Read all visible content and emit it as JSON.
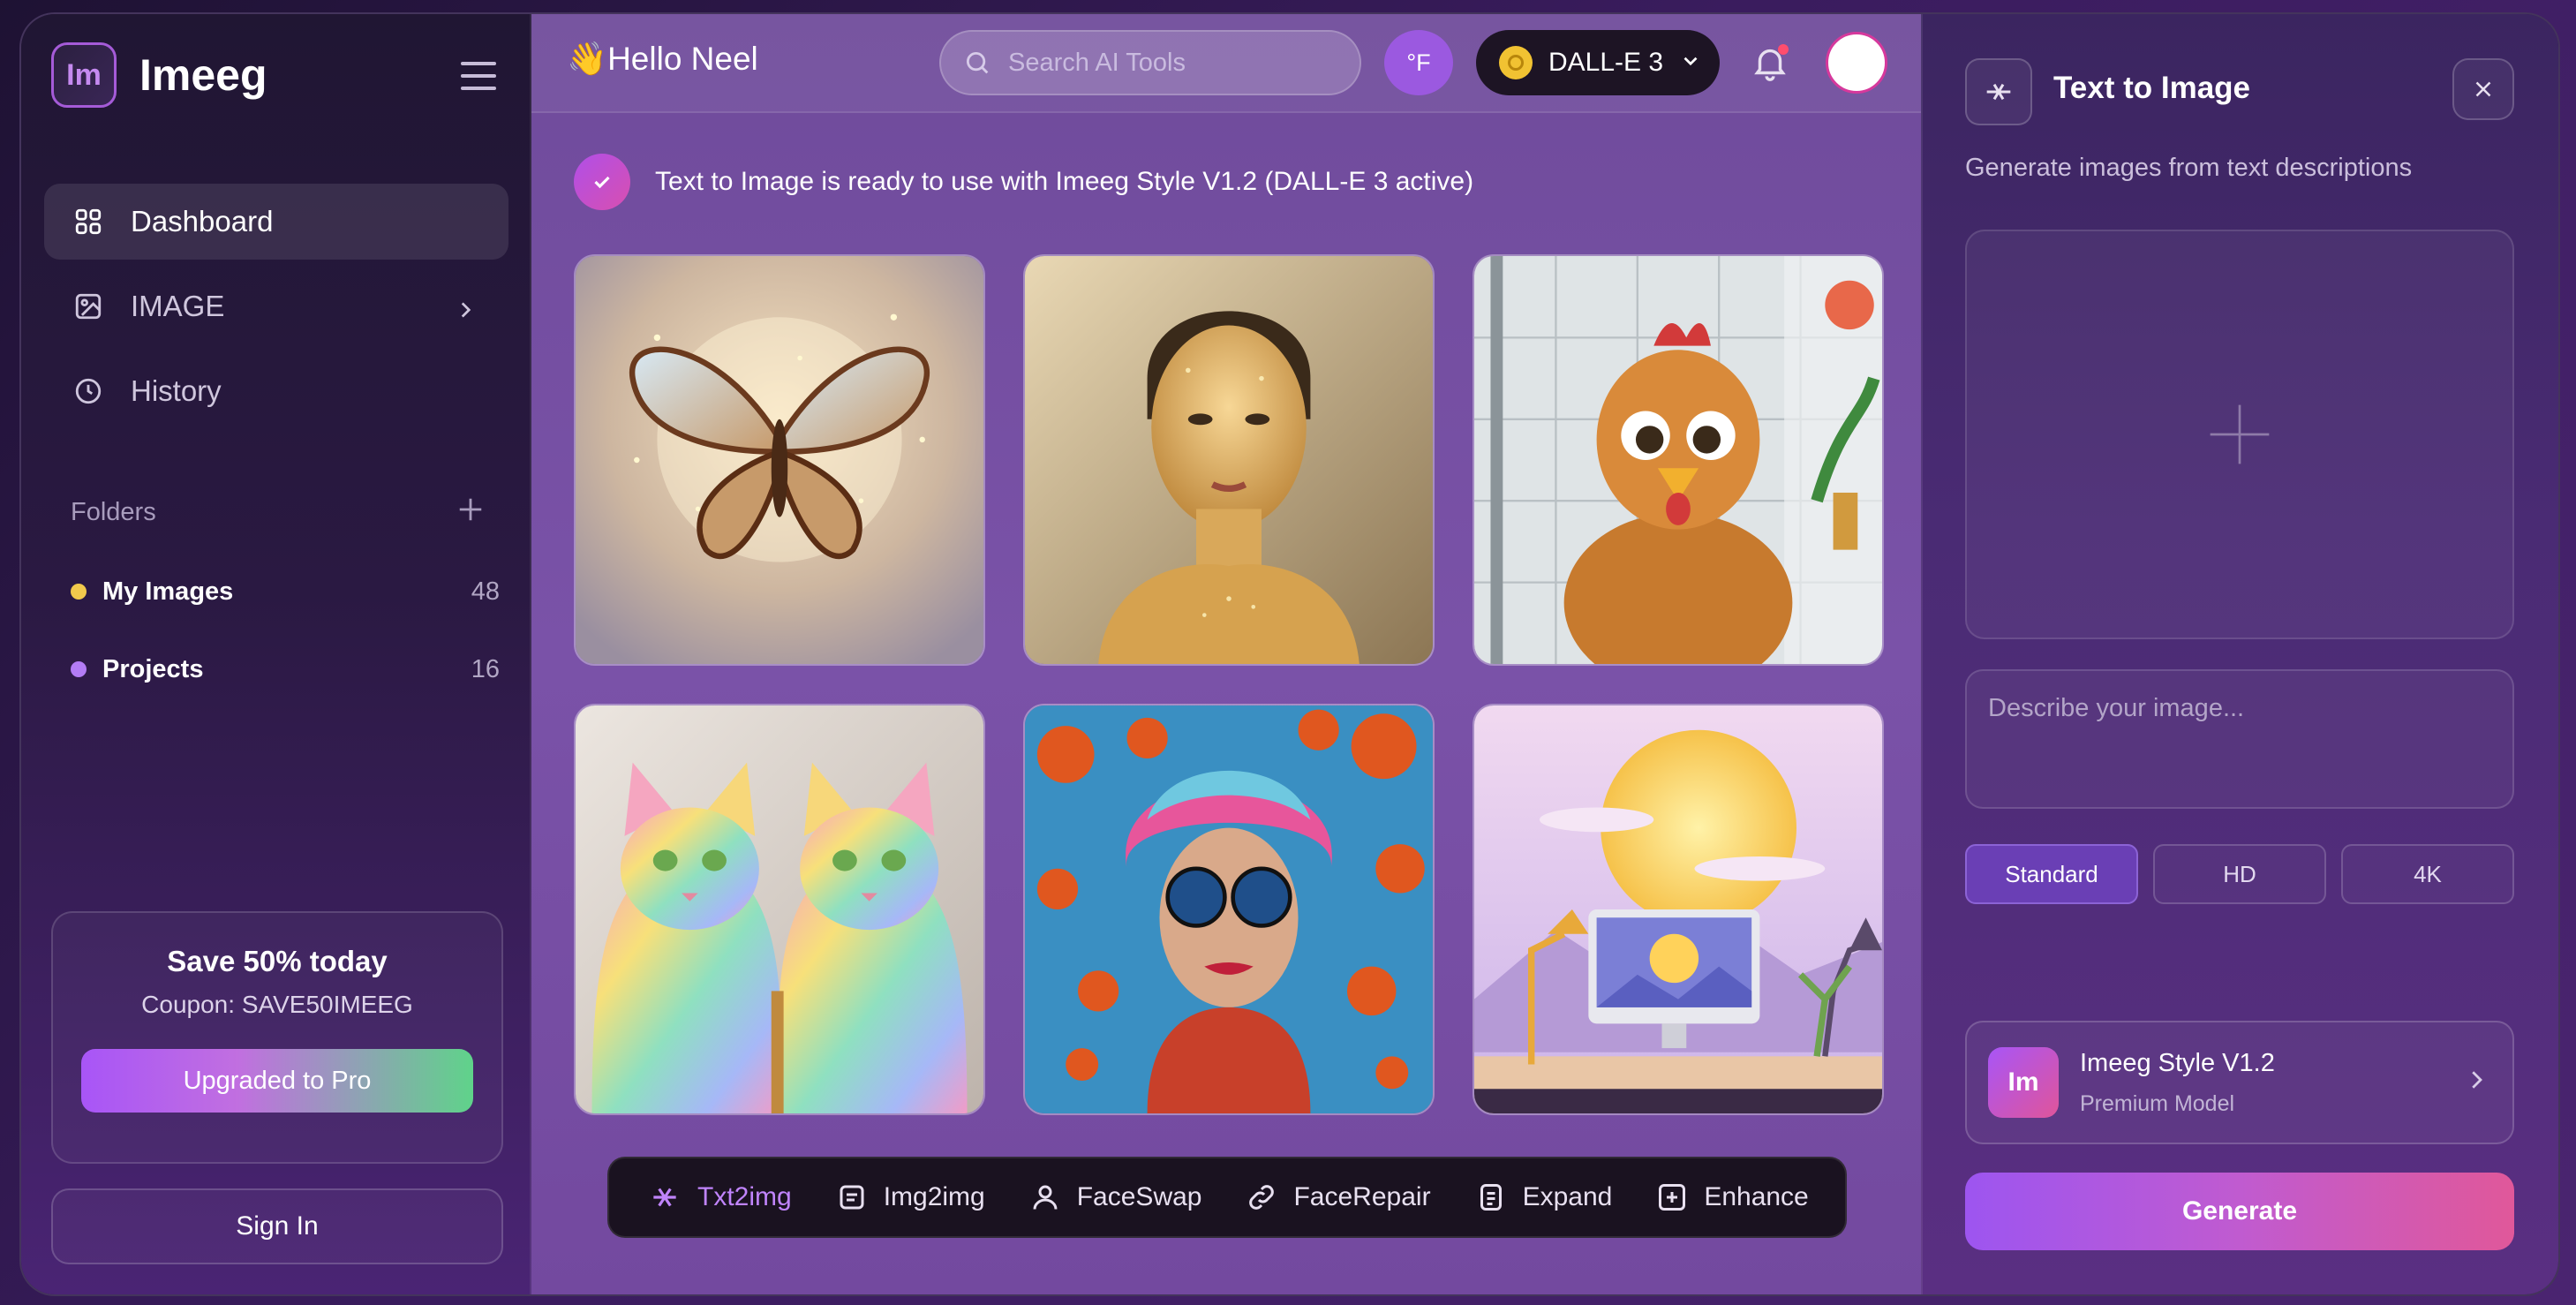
{
  "app": {
    "logo_text": "Im",
    "name": "Imeeg"
  },
  "sidebar": {
    "items": [
      {
        "label": "Dashboard",
        "icon": "grid-icon",
        "active": true
      },
      {
        "label": "IMAGE",
        "icon": "image-icon"
      },
      {
        "label": "History",
        "icon": "clock-icon"
      }
    ],
    "folders_title": "Folders",
    "folders": [
      {
        "name": "My Images",
        "count": "48",
        "color": "#f2c94c"
      },
      {
        "name": "Projects",
        "count": "16",
        "color": "#b37cf5"
      }
    ],
    "promo": {
      "title": "Save 50% today",
      "coupon": "Coupon: SAVE50IMEEG",
      "button": "Upgraded to Pro"
    },
    "sign_in": "Sign In"
  },
  "header": {
    "greeting_emoji": "👋",
    "greeting": "Hello Neel",
    "search_placeholder": "Search AI Tools",
    "temp_unit": "°F",
    "model": "DALL-E 3"
  },
  "notice": {
    "text": "Text to Image is ready to use with Imeeg Style V1.2 (DALL-E 3 active)"
  },
  "gallery": [
    {
      "subject": "glowing butterfly"
    },
    {
      "subject": "golden portrait"
    },
    {
      "subject": "cartoon chicken in shower"
    },
    {
      "subject": "rainbow cats"
    },
    {
      "subject": "pop art woman with sunglasses"
    },
    {
      "subject": "desk with sunset scene"
    }
  ],
  "toolbar": {
    "tools": [
      {
        "label": "Txt2img",
        "icon": "text-to-image-icon",
        "active": true
      },
      {
        "label": "Img2img",
        "icon": "document-icon"
      },
      {
        "label": "FaceSwap",
        "icon": "user-icon"
      },
      {
        "label": "FaceRepair",
        "icon": "link-icon"
      },
      {
        "label": "Expand",
        "icon": "expand-icon"
      },
      {
        "label": "Enhance",
        "icon": "plus-square-icon"
      }
    ]
  },
  "panel": {
    "title": "Text to Image",
    "subtitle": "Generate images from text descriptions",
    "prompt_placeholder": "Describe your image...",
    "qualities": [
      "Standard",
      "HD",
      "4K"
    ],
    "selected_quality": "Standard",
    "model_card": {
      "logo": "Im",
      "name": "Imeeg Style V1.2",
      "tier": "Premium Model"
    },
    "generate": "Generate"
  },
  "colors": {
    "accent": "#a855f7",
    "pink": "#e0589a",
    "green": "#5fd38a"
  }
}
